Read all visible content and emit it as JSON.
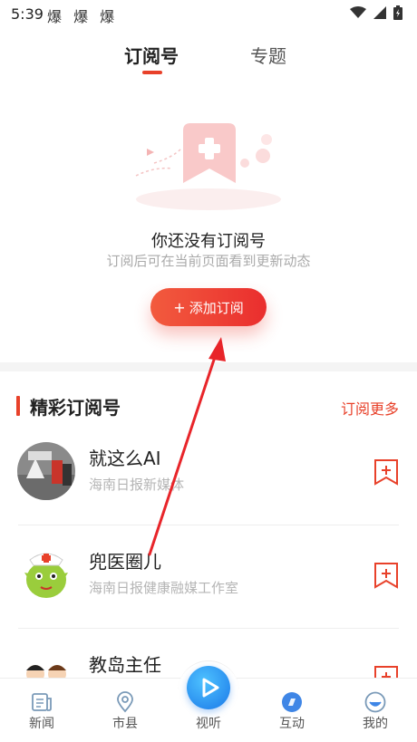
{
  "status_bar": {
    "time": "5:39",
    "notification_icons": "爆 爆 爆"
  },
  "tabs": [
    {
      "label": "订阅号",
      "active": true
    },
    {
      "label": "专题",
      "active": false
    }
  ],
  "empty_state": {
    "title": "你还没有订阅号",
    "subtitle": "订阅后可在当前页面看到更新动态",
    "button_label": "添加订阅",
    "button_plus": "+"
  },
  "featured": {
    "title": "精彩订阅号",
    "more_label": "订阅更多",
    "items": [
      {
        "name": "就这么AI",
        "desc": "海南日报新媒体",
        "icon": "add-subscription-icon"
      },
      {
        "name": "兜医圈儿",
        "desc": "海南日报健康融媒工作室",
        "icon": "add-subscription-icon"
      },
      {
        "name": "教岛主任",
        "desc": "",
        "icon": "add-subscription-icon"
      }
    ]
  },
  "bottom_nav": [
    {
      "label": "新闻",
      "icon": "news-icon"
    },
    {
      "label": "市县",
      "icon": "location-icon"
    },
    {
      "label": "视听",
      "icon": "play-icon"
    },
    {
      "label": "互动",
      "icon": "interact-icon"
    },
    {
      "label": "我的",
      "icon": "profile-icon"
    }
  ],
  "colors": {
    "accent": "#e8412a",
    "video_blue": "#1a78e8"
  }
}
